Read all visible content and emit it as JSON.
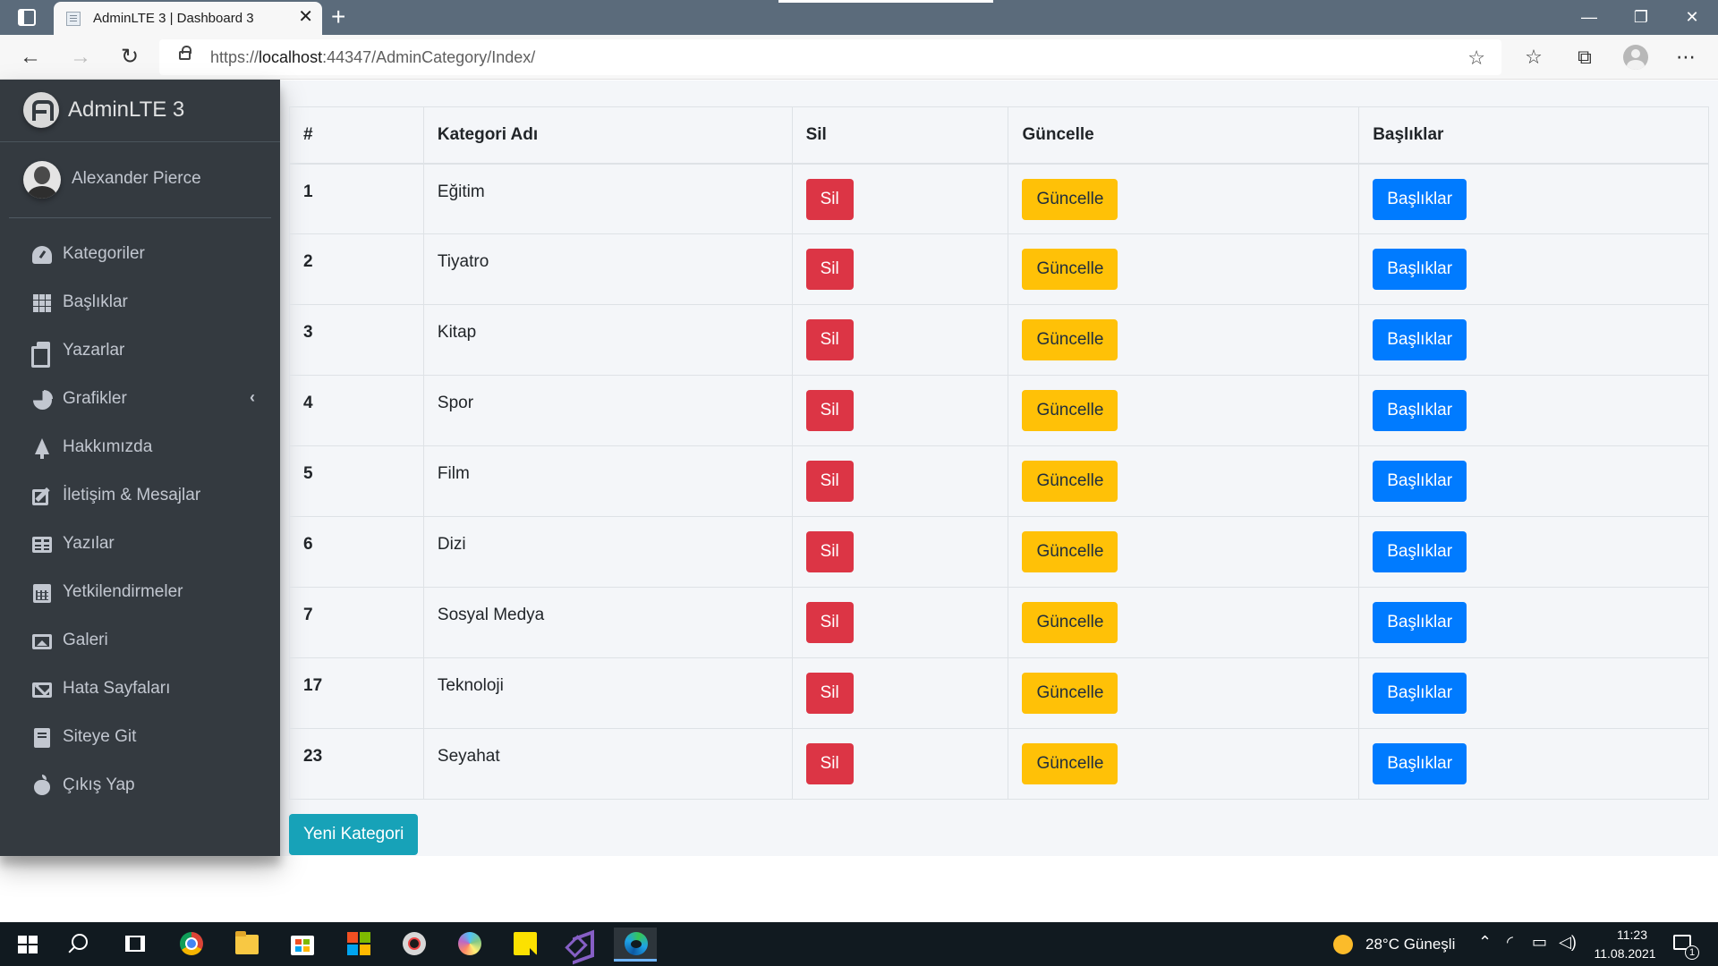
{
  "browser": {
    "tab_title": "AdminLTE 3 | Dashboard 3",
    "url_prefix": "https://",
    "url_host": "localhost",
    "url_rest": ":44347/AdminCategory/Index/"
  },
  "sidebar": {
    "brand": "AdminLTE 3",
    "user_name": "Alexander Pierce",
    "items": [
      {
        "label": "Kategoriler",
        "icon": "tachometer-icon"
      },
      {
        "label": "Başlıklar",
        "icon": "grid-icon"
      },
      {
        "label": "Yazarlar",
        "icon": "copy-icon"
      },
      {
        "label": "Grafikler",
        "icon": "pie-chart-icon"
      },
      {
        "label": "Hakkımızda",
        "icon": "tree-icon"
      },
      {
        "label": "İletişim & Mesajlar",
        "icon": "edit-icon"
      },
      {
        "label": "Yazılar",
        "icon": "table-icon"
      },
      {
        "label": "Yetkilendirmeler",
        "icon": "calendar-icon"
      },
      {
        "label": "Galeri",
        "icon": "image-icon"
      },
      {
        "label": "Hata Sayfaları",
        "icon": "envelope-icon"
      },
      {
        "label": "Siteye Git",
        "icon": "book-icon"
      },
      {
        "label": "Çıkış Yap",
        "icon": "apple-icon"
      }
    ]
  },
  "table": {
    "headers": [
      "#",
      "Kategori Adı",
      "Sil",
      "Güncelle",
      "Başlıklar"
    ],
    "rows": [
      {
        "id": "1",
        "name": "Eğitim"
      },
      {
        "id": "2",
        "name": "Tiyatro"
      },
      {
        "id": "3",
        "name": "Kitap"
      },
      {
        "id": "4",
        "name": "Spor"
      },
      {
        "id": "5",
        "name": "Film"
      },
      {
        "id": "6",
        "name": "Dizi"
      },
      {
        "id": "7",
        "name": "Sosyal Medya"
      },
      {
        "id": "17",
        "name": "Teknoloji"
      },
      {
        "id": "23",
        "name": "Seyahat"
      }
    ],
    "delete_label": "Sil",
    "update_label": "Güncelle",
    "titles_label": "Başlıklar"
  },
  "new_category_label": "Yeni Kategori",
  "colors": {
    "sidebar_bg": "#343a40",
    "danger": "#dc3545",
    "warning": "#ffc107",
    "primary": "#007bff",
    "info": "#17a2b8"
  },
  "taskbar": {
    "weather": "28°C  Güneşli",
    "time": "11:23",
    "date": "11.08.2021",
    "notification_count": "1"
  }
}
